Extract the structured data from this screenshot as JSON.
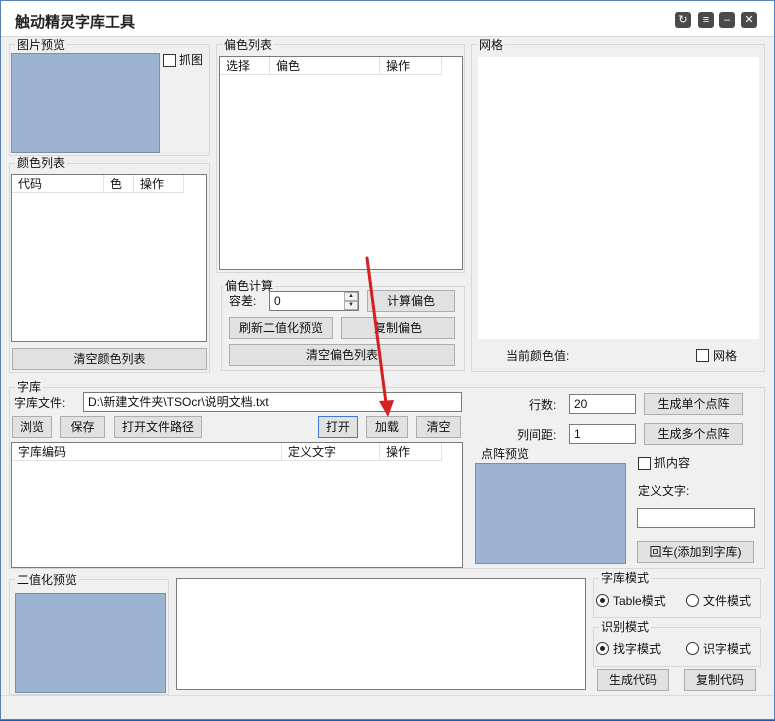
{
  "window": {
    "title": "触动精灵字库工具"
  },
  "titlebar_buttons": [
    "refresh-icon",
    "menu-icon",
    "minimize-icon",
    "close-icon"
  ],
  "image_preview": {
    "label": "图片预览",
    "grab_checkbox": "抓图",
    "grab_checked": false
  },
  "color_list": {
    "label": "颜色列表",
    "columns": [
      "代码",
      "色",
      "操作"
    ],
    "clear_button": "清空颜色列表"
  },
  "offset_list": {
    "label": "偏色列表",
    "columns": [
      "选择",
      "偏色",
      "操作"
    ]
  },
  "offset_calc": {
    "label": "偏色计算",
    "tolerance_label": "容差:",
    "tolerance_value": "0",
    "calc_button": "计算偏色",
    "refresh_button": "刷新二值化预览",
    "copy_button": "复制偏色",
    "clear_button": "清空偏色列表"
  },
  "grid": {
    "label": "网格",
    "current_color_label": "当前颜色值:",
    "grid_checkbox": "网格",
    "grid_checked": false
  },
  "font_lib": {
    "label": "字库",
    "file_label": "字库文件:",
    "file_value": "D:\\新建文件夹\\TSOcr\\说明文档.txt",
    "browse_button": "浏览",
    "save_button": "保存",
    "open_path_button": "打开文件路径",
    "open_button": "打开",
    "load_button": "加载",
    "clear_button": "清空",
    "columns": [
      "字库编码",
      "定义文字",
      "操作"
    ]
  },
  "matrix": {
    "rows_label": "行数:",
    "rows_value": "20",
    "col_spacing_label": "列间距:",
    "col_spacing_value": "1",
    "single_button": "生成单个点阵",
    "multi_button": "生成多个点阵",
    "preview_label": "点阵预览",
    "grab_content_checkbox": "抓内容",
    "grab_content_checked": false,
    "define_text_label": "定义文字:",
    "define_text_value": "",
    "enter_button": "回车(添加到字库)"
  },
  "binary_preview": {
    "label": "二值化预览"
  },
  "lib_mode": {
    "label": "字库模式",
    "options": [
      "Table模式",
      "文件模式"
    ],
    "selected": "Table模式"
  },
  "recog_mode": {
    "label": "识别模式",
    "options": [
      "找字模式",
      "识字模式"
    ],
    "selected": "找字模式"
  },
  "footer": {
    "generate_button": "生成代码",
    "copy_button": "复制代码"
  },
  "colors": {
    "preview_fill": "#9cb4d2",
    "arrow": "#d42020",
    "desktop": "#1e5aa8"
  }
}
